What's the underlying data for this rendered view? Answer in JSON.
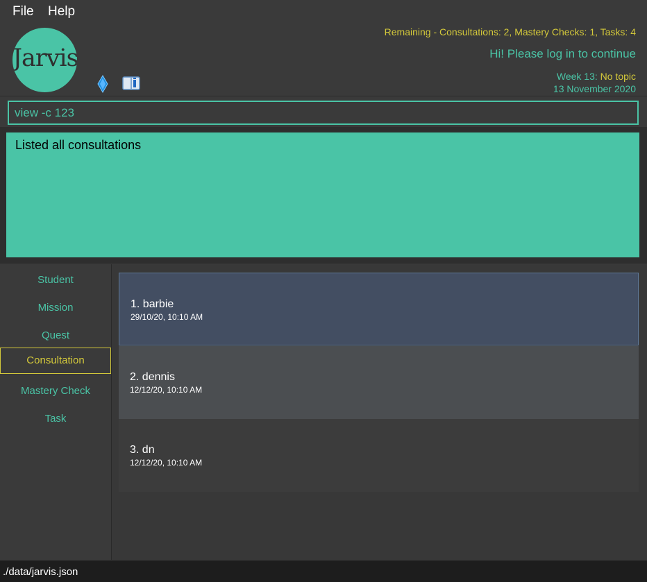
{
  "menu": {
    "file": "File",
    "help": "Help"
  },
  "logo": {
    "text": "Jarvis"
  },
  "header": {
    "remaining": "Remaining - Consultations: 2, Mastery Checks: 1, Tasks: 4",
    "greeting": "Hi! Please log in to continue",
    "week_label": "Week 13: ",
    "week_topic": "No topic",
    "date": "13 November 2020"
  },
  "command": {
    "value": "view -c 123"
  },
  "result": {
    "text": "Listed all consultations"
  },
  "sidebar": {
    "items": [
      {
        "label": "Student",
        "selected": false
      },
      {
        "label": "Mission",
        "selected": false
      },
      {
        "label": "Quest",
        "selected": false
      },
      {
        "label": "Consultation",
        "selected": true
      },
      {
        "label": "Mastery Check",
        "selected": false
      },
      {
        "label": "Task",
        "selected": false
      }
    ]
  },
  "consultations": [
    {
      "title": "1.  barbie",
      "datetime": "29/10/20, 10:10 AM"
    },
    {
      "title": "2.  dennis",
      "datetime": "12/12/20, 10:10 AM"
    },
    {
      "title": "3.  dn",
      "datetime": "12/12/20, 10:10 AM"
    }
  ],
  "status": {
    "path": "./data/jarvis.json"
  },
  "colors": {
    "accent": "#4ac4a6",
    "highlight": "#d4c93a",
    "background": "#3a3a3a"
  },
  "icons": {
    "diamond": "diamond-icon",
    "manual": "user-guide-icon"
  }
}
